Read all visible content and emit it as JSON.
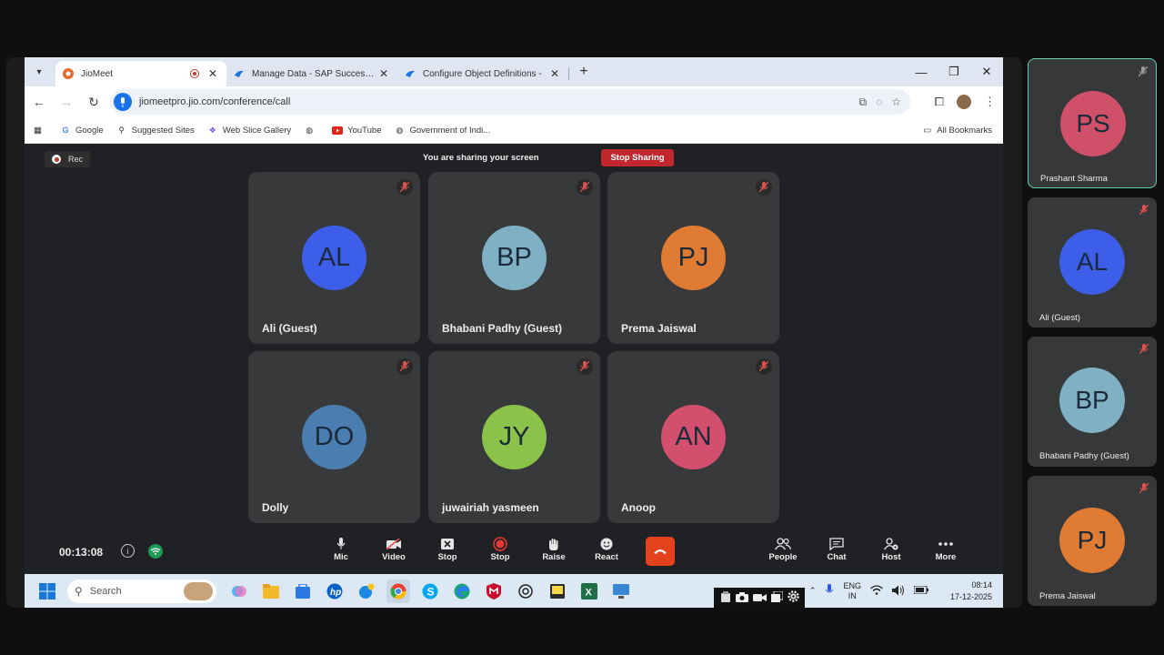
{
  "browser": {
    "tabs": [
      {
        "title": "JioMeet",
        "active": true,
        "recording": true
      },
      {
        "title": "Manage Data - SAP SuccessFac",
        "active": false
      },
      {
        "title": "Configure Object Definitions - ",
        "active": false
      }
    ],
    "url": "jiomeetpro.jio.com/conference/call",
    "bookmarks": [
      "Google",
      "Suggested Sites",
      "Web Slice Gallery",
      "YouTube",
      "Government of Indi..."
    ],
    "all_bookmarks": "All Bookmarks"
  },
  "meeting": {
    "rec_label": "Rec",
    "sharing_text": "You are sharing your screen",
    "stop_sharing_label": "Stop Sharing",
    "timer": "00:13:08",
    "participants": [
      {
        "initials": "AL",
        "name": "Ali (Guest)",
        "color": "#3d5ee8"
      },
      {
        "initials": "BP",
        "name": "Bhabani Padhy (Guest)",
        "color": "#7fb0c4"
      },
      {
        "initials": "PJ",
        "name": "Prema Jaiswal",
        "color": "#e07b34"
      },
      {
        "initials": "DO",
        "name": "Dolly",
        "color": "#4a7eb0"
      },
      {
        "initials": "JY",
        "name": "juwairiah yasmeen",
        "color": "#8bc24a"
      },
      {
        "initials": "AN",
        "name": "Anoop",
        "color": "#d34f6e"
      }
    ],
    "controls": {
      "mic": "Mic",
      "video": "Video",
      "stop_share": "Stop",
      "stop_rec": "Stop",
      "raise": "Raise",
      "react": "React",
      "people": "People",
      "chat": "Chat",
      "host": "Host",
      "more": "More"
    }
  },
  "taskbar": {
    "search_placeholder": "Search",
    "lang_top": "ENG",
    "lang_bottom": "IN",
    "time": "08:14",
    "date": "17-12-2025"
  },
  "sidebar_participants": [
    {
      "initials": "PS",
      "name": "Prashant Sharma",
      "color": "#d0506a",
      "active": true
    },
    {
      "initials": "AL",
      "name": "Ali (Guest)",
      "color": "#3d5ee8"
    },
    {
      "initials": "BP",
      "name": "Bhabani Padhy (Guest)",
      "color": "#7fb0c4"
    },
    {
      "initials": "PJ",
      "name": "Prema Jaiswal",
      "color": "#e07b34"
    }
  ],
  "colors": {
    "stop_sharing": "#c1272d",
    "end_call": "#e4431e",
    "tile_bg": "#38393b",
    "active_speaker_border": "#5fd0b0"
  }
}
